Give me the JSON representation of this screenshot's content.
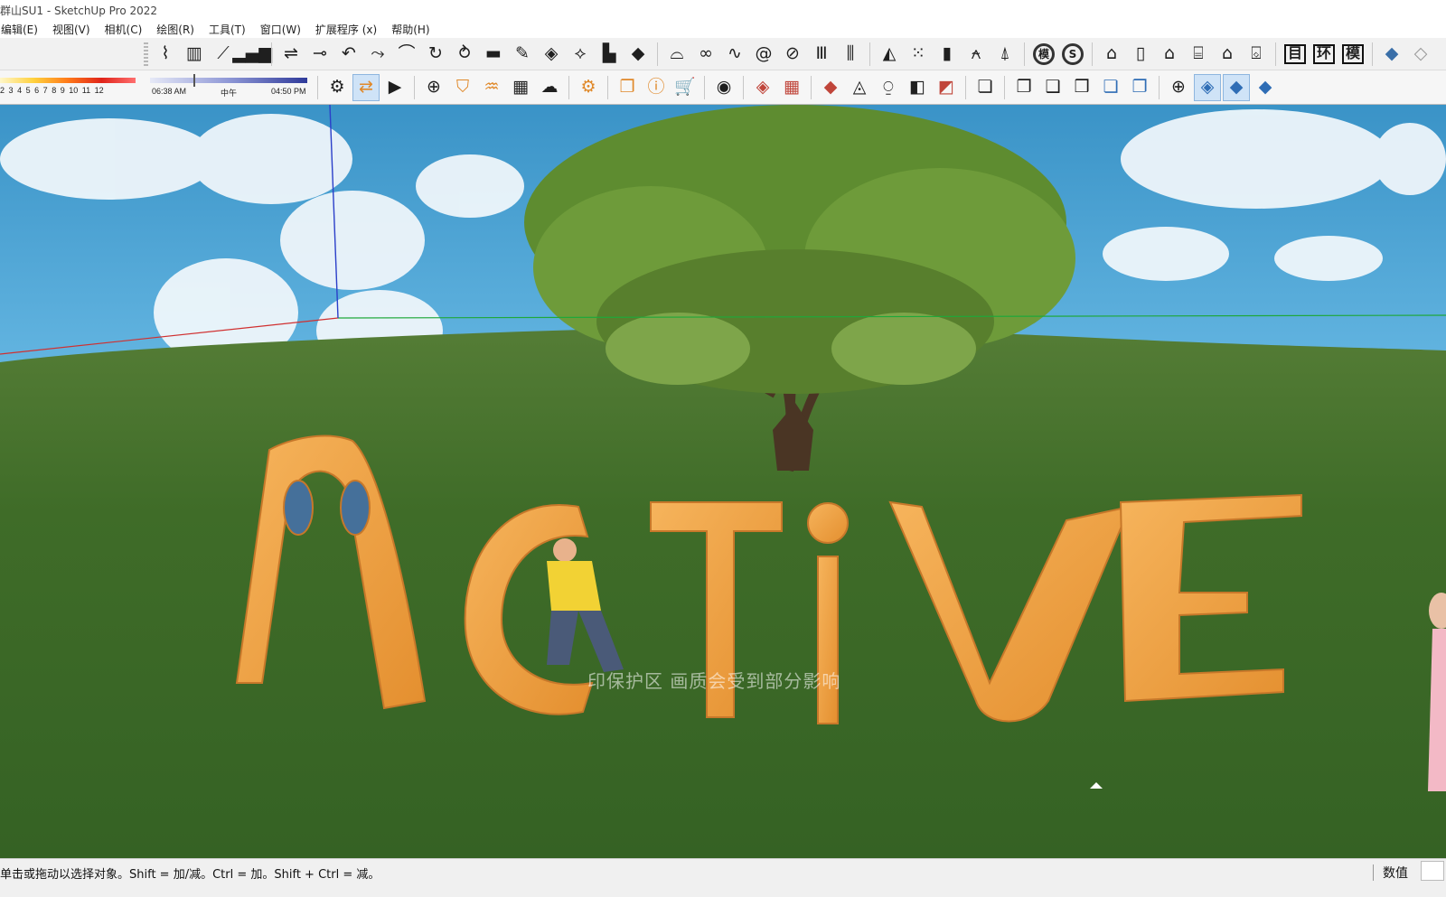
{
  "window": {
    "title": "群山SU1 - SketchUp Pro 2022"
  },
  "menu": [
    {
      "label": "编辑(E)"
    },
    {
      "label": "视图(V)"
    },
    {
      "label": "相机(C)"
    },
    {
      "label": "绘图(R)"
    },
    {
      "label": "工具(T)"
    },
    {
      "label": "窗口(W)"
    },
    {
      "label": "扩展程序 (x)"
    },
    {
      "label": "帮助(H)"
    }
  ],
  "toolbar_top": {
    "box_labels": [
      "目",
      "环",
      "模"
    ],
    "circle_labels": [
      "模",
      "S"
    ]
  },
  "shadow_ramp": {
    "ticks": [
      "2",
      "3",
      "4",
      "5",
      "6",
      "7",
      "8",
      "9",
      "10",
      "11",
      "12"
    ]
  },
  "time_slider": {
    "start": "06:38 AM",
    "noon": "中午",
    "end": "04:50 PM"
  },
  "viewport": {
    "sculpture_text": "ACTIVE",
    "watermark_text": "印保护区   画质会受到部分影响",
    "sky_color": "#5fb3e1",
    "grass_color": "#3f6e2a",
    "letter_color": "#f0a04a",
    "axis_colors": {
      "red": "#d03030",
      "green": "#1fa83a",
      "blue": "#2b3fc9"
    }
  },
  "status": {
    "hint": "单击或拖动以选择对象。Shift = 加/减。Ctrl = 加。Shift + Ctrl = 减。",
    "value_label": "数值",
    "value": ""
  }
}
